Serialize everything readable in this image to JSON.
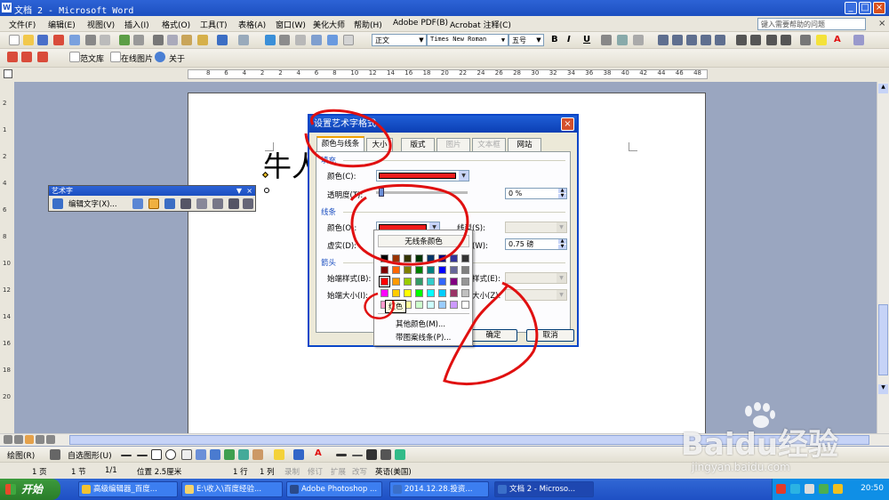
{
  "window": {
    "title": "文档 2 - Microsoft Word",
    "controls": [
      "_",
      "□",
      "×"
    ]
  },
  "menu": {
    "items": [
      "文件(F)",
      "编辑(E)",
      "视图(V)",
      "插入(I)",
      "格式(O)",
      "工具(T)",
      "表格(A)",
      "窗口(W)",
      "美化大师",
      "帮助(H)",
      "Adobe PDF(B)",
      "Acrobat 注释(C)"
    ],
    "help_placeholder": "键入需要帮助的问题"
  },
  "format_toolbar": {
    "style": "正文",
    "font": "Times New Roman",
    "size": "五号",
    "bold": "B",
    "italic": "I",
    "underline": "U"
  },
  "toolbar3": {
    "fanwenku": "范文库",
    "online_image": "在线图片",
    "about": "关于"
  },
  "ruler": {
    "numbers": [
      "8",
      "6",
      "4",
      "2",
      "2",
      "4",
      "6",
      "8",
      "10",
      "12",
      "14",
      "16",
      "18",
      "20",
      "22",
      "24",
      "26",
      "28",
      "30",
      "32",
      "34",
      "36",
      "38",
      "40",
      "42",
      "44",
      "46",
      "48"
    ],
    "left_numbers": [
      "2",
      "1",
      "2",
      "4",
      "6",
      "8",
      "10",
      "12",
      "14",
      "16",
      "18",
      "20"
    ]
  },
  "document": {
    "wordart_text": "牛人"
  },
  "wordart_toolbar": {
    "title": "艺术字",
    "edit_text": "编辑文字(X)..."
  },
  "dialog": {
    "title": "设置艺术字格式",
    "tabs": [
      "颜色与线条",
      "大小",
      "版式",
      "图片",
      "文本框",
      "网站"
    ],
    "fill_section": "填充",
    "fill_color_label": "颜色(C):",
    "fill_color": "#ef1c1c",
    "transparency_label": "透明度(T):",
    "transparency_value": "0 %",
    "line_section": "线条",
    "line_color_label": "颜色(O):",
    "line_color": "#ef1c1c",
    "line_style_label": "线型(S):",
    "dash_label": "虚实(D):",
    "weight_label": "粗细(W):",
    "weight_value": "0.75 磅",
    "arrow_section": "箭头",
    "begin_style_label": "始端样式(B):",
    "end_style_label": "末端样式(E):",
    "begin_size_label": "始端大小(I):",
    "end_size_label": "末端大小(Z):",
    "ok": "确定",
    "cancel": "取消"
  },
  "color_popup": {
    "no_color": "无线条颜色",
    "tooltip": "红色",
    "more_colors": "其他颜色(M)...",
    "patterned_lines": "带图案线条(P)...",
    "rows": [
      [
        "#000000",
        "#993300",
        "#333300",
        "#003300",
        "#003366",
        "#000080",
        "#333399",
        "#333333"
      ],
      [
        "#800000",
        "#ff6600",
        "#808000",
        "#008000",
        "#008080",
        "#0000ff",
        "#666699",
        "#808080"
      ],
      [
        "#ff0000",
        "#ff9900",
        "#99cc00",
        "#339966",
        "#33cccc",
        "#3366ff",
        "#800080",
        "#969696"
      ],
      [
        "#ff00ff",
        "#ffcc00",
        "#ffff00",
        "#00ff00",
        "#00ffff",
        "#00ccff",
        "#993366",
        "#c0c0c0"
      ],
      [
        "#ff99cc",
        "#ffcc99",
        "#ffff99",
        "#ccffcc",
        "#ccffff",
        "#99ccff",
        "#cc99ff",
        "#ffffff"
      ]
    ]
  },
  "draw_toolbar": {
    "draw": "绘图(R)",
    "autoshapes": "自选图形(U)"
  },
  "status": {
    "page": "1 页",
    "section": "1 节",
    "pages": "1/1",
    "position": "位置 2.5厘米",
    "line": "1 行",
    "col": "1 列",
    "rec": "录制",
    "trk": "修订",
    "ext": "扩展",
    "ovr": "改写",
    "lang": "英语(美国)"
  },
  "taskbar": {
    "start": "开始",
    "tasks": [
      "高级编辑器_百度...",
      "E:\\收入\\百度经验...",
      "Adobe Photoshop ...",
      "2014.12.28.投资...",
      "文档 2 - Microso..."
    ],
    "clock": "20:50"
  },
  "watermark": {
    "brand": "Baidu经验",
    "url": "jingyan.baidu.com"
  },
  "colors": {
    "titlebar": "#1c4fc0",
    "annotation": "#e01010"
  }
}
